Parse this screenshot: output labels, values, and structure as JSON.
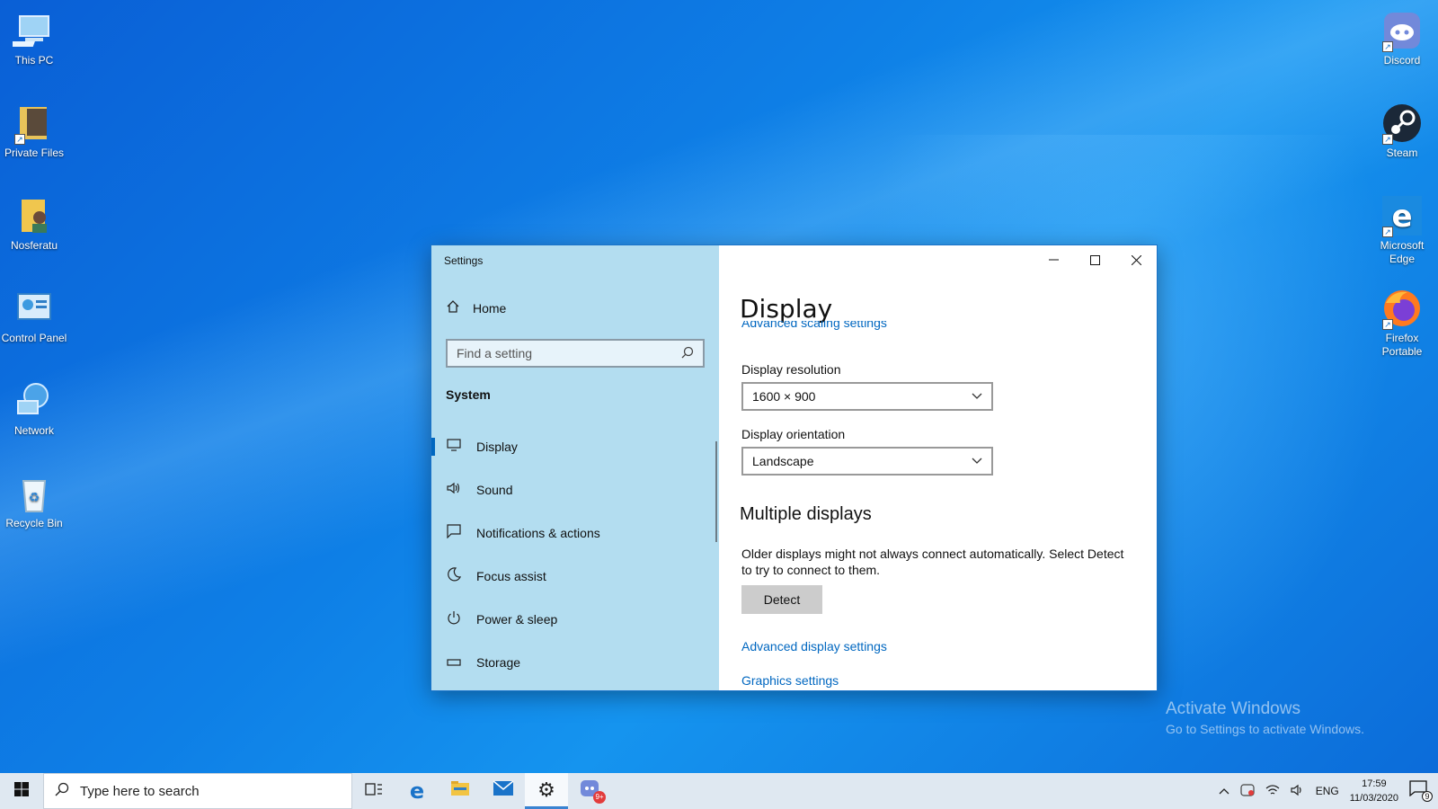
{
  "desktop": {
    "left_icons": [
      {
        "label": "This PC",
        "icon": "this-pc-icon"
      },
      {
        "label": "Private Files",
        "icon": "folder-image-icon"
      },
      {
        "label": "Nosferatu",
        "icon": "folder-user-icon"
      },
      {
        "label": "Control Panel",
        "icon": "control-panel-icon"
      },
      {
        "label": "Network",
        "icon": "network-icon"
      },
      {
        "label": "Recycle Bin",
        "icon": "recycle-bin-icon"
      }
    ],
    "right_icons": [
      {
        "label": "Discord",
        "icon": "discord-icon"
      },
      {
        "label": "Steam",
        "icon": "steam-icon"
      },
      {
        "label": "Microsoft Edge",
        "icon": "edge-icon"
      },
      {
        "label": "Firefox Portable",
        "icon": "firefox-icon"
      }
    ],
    "watermark": {
      "line1": "Activate Windows",
      "line2": "Go to Settings to activate Windows."
    }
  },
  "settings": {
    "window_title": "Settings",
    "home_label": "Home",
    "search_placeholder": "Find a setting",
    "section": "System",
    "nav": [
      {
        "label": "Display",
        "icon": "monitor-icon",
        "active": true
      },
      {
        "label": "Sound",
        "icon": "speaker-icon",
        "active": false
      },
      {
        "label": "Notifications & actions",
        "icon": "notifications-icon",
        "active": false
      },
      {
        "label": "Focus assist",
        "icon": "moon-icon",
        "active": false
      },
      {
        "label": "Power & sleep",
        "icon": "power-icon",
        "active": false
      },
      {
        "label": "Storage",
        "icon": "storage-icon",
        "active": false
      }
    ],
    "main": {
      "title": "Display",
      "clipped_link": "Advanced scaling settings",
      "resolution_label": "Display resolution",
      "resolution_value": "1600 × 900",
      "orientation_label": "Display orientation",
      "orientation_value": "Landscape",
      "multiple_title": "Multiple displays",
      "multiple_desc": "Older displays might not always connect automatically. Select Detect to try to connect to them.",
      "detect_label": "Detect",
      "advanced_link": "Advanced display settings",
      "graphics_link": "Graphics settings"
    }
  },
  "taskbar": {
    "search_placeholder": "Type here to search",
    "apps": [
      "task-view-icon",
      "edge-icon",
      "file-explorer-icon",
      "mail-icon",
      "settings-gear-icon",
      "discord-icon"
    ],
    "discord_badge": "9+",
    "language": "ENG",
    "time": "17:59",
    "date": "11/03/2020",
    "notification_count": "9"
  },
  "colors": {
    "accent": "#0067c0",
    "sidebar": "#b3ddf0",
    "taskbar": "#dfe8f1"
  }
}
